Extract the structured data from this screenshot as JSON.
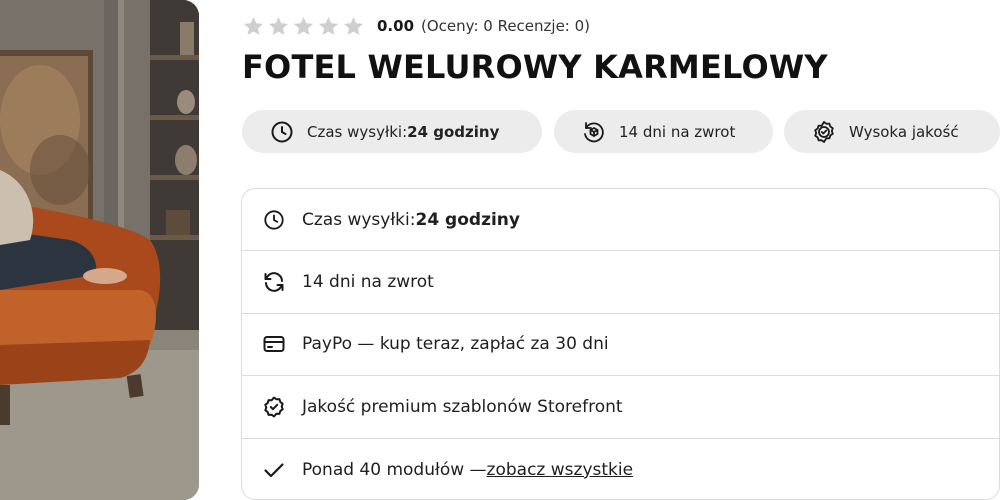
{
  "rating": {
    "stars_filled": 0,
    "stars_total": 5,
    "value": "0.00",
    "meta": "(Oceny: 0 Recenzje: 0)",
    "star_color": "#cfcfcf"
  },
  "product": {
    "title": "FOTEL WELUROWY KARMELOWY",
    "image_icon": "product-photo-velvet-armchair"
  },
  "pills": [
    {
      "icon": "clock-icon",
      "label": "Czas wysyłki: ",
      "bold": "24 godziny"
    },
    {
      "icon": "return-box-icon",
      "label": "14 dni na zwrot",
      "bold": ""
    },
    {
      "icon": "quality-badge-icon",
      "label": "Wysoka jakość",
      "bold": ""
    }
  ],
  "features": [
    {
      "icon": "clock-icon",
      "label": "Czas wysyłki: ",
      "bold": "24 godziny"
    },
    {
      "icon": "refresh-icon",
      "label": "14 dni na zwrot"
    },
    {
      "icon": "credit-card-icon",
      "label": "PayPo — kup teraz, zapłać za 30 dni"
    },
    {
      "icon": "badge-check-icon",
      "label": "Jakość premium szablonów Storefront"
    },
    {
      "icon": "check-icon",
      "label": "Ponad 40 modułów — ",
      "link": "zobacz wszystkie"
    }
  ],
  "colors": {
    "pill_bg": "#ececec",
    "border": "#dcdcdc",
    "chair": "#b5531f"
  }
}
